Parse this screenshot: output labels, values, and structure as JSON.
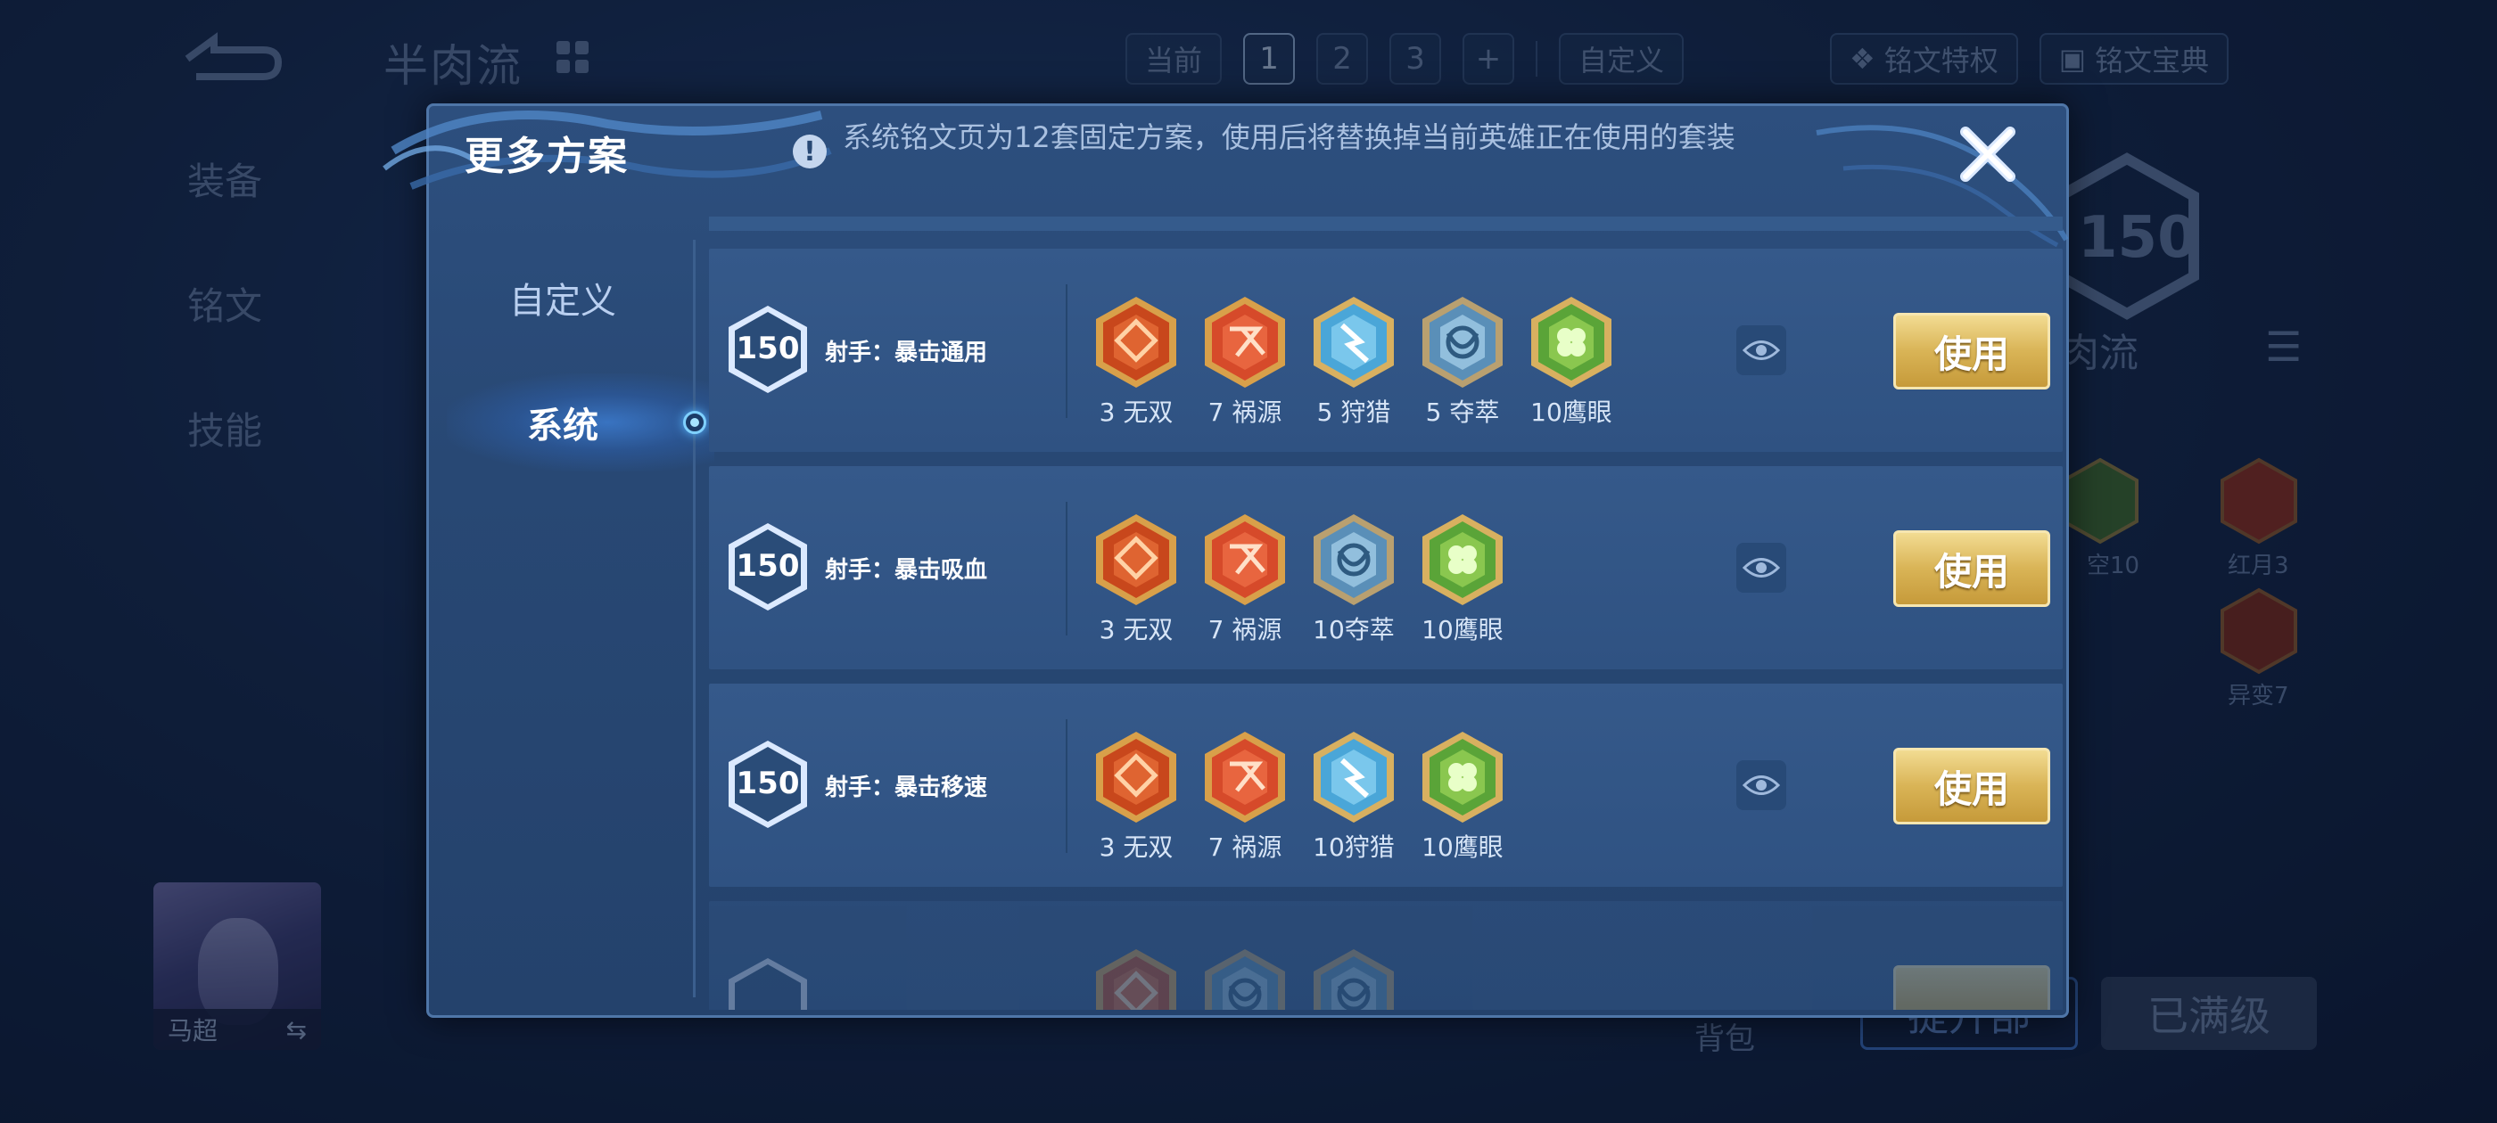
{
  "background": {
    "plan_name": "半肉流",
    "top_controls": {
      "current_label": "当前",
      "pages": [
        "1",
        "2",
        "3"
      ],
      "add_label": "+",
      "custom_label": "自定义",
      "privilege_label": "铭文特权",
      "codex_label": "铭文宝典"
    },
    "side_nav": [
      "装备",
      "铭文",
      "技能"
    ],
    "level_badge": "150",
    "plan_name_right": "肉流",
    "rune_labels": [
      "空10",
      "红月3",
      "异变7"
    ],
    "hero_name": "马超",
    "bag_label": "背包",
    "upgrade_label": "提升部",
    "maxed_label": "已满级"
  },
  "modal": {
    "title": "更多方案",
    "info_text": "系统铭文页为12套固定方案，使用后将替换掉当前英雄正在使用的套装",
    "tabs": {
      "custom": "自定义",
      "system": "系统"
    },
    "rows": [
      {
        "level": "150",
        "name": "射手：暴击通用",
        "runes": [
          {
            "type": "red",
            "label": "3 无双"
          },
          {
            "type": "red2",
            "label": "7 祸源"
          },
          {
            "type": "blue",
            "label": "5 狩猎"
          },
          {
            "type": "blue2",
            "label": "5 夺萃"
          },
          {
            "type": "green",
            "label": "10鹰眼"
          }
        ],
        "use_label": "使用"
      },
      {
        "level": "150",
        "name": "射手：暴击吸血",
        "runes": [
          {
            "type": "red",
            "label": "3 无双"
          },
          {
            "type": "red2",
            "label": "7 祸源"
          },
          {
            "type": "blue2",
            "label": "10夺萃"
          },
          {
            "type": "green",
            "label": "10鹰眼"
          }
        ],
        "use_label": "使用"
      },
      {
        "level": "150",
        "name": "射手：暴击移速",
        "runes": [
          {
            "type": "red",
            "label": "3 无双"
          },
          {
            "type": "red2",
            "label": "7 祸源"
          },
          {
            "type": "blue",
            "label": "10狩猎"
          },
          {
            "type": "green",
            "label": "10鹰眼"
          }
        ],
        "use_label": "使用"
      }
    ]
  },
  "colors": {
    "modal_bg": "#284874",
    "row_bg": "#33578a",
    "use_button": "#d9b456",
    "accent_glow": "#5ab8ff"
  }
}
